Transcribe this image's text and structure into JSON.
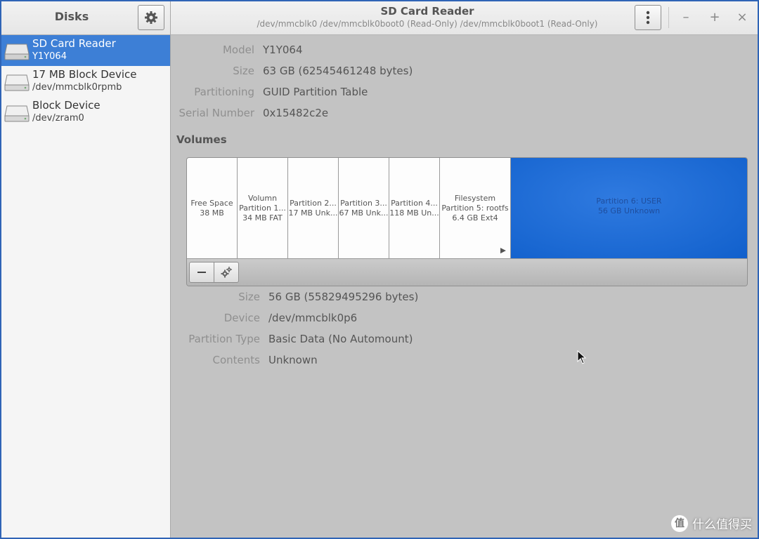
{
  "sidebar": {
    "title": "Disks",
    "disks": [
      {
        "name": "SD Card Reader",
        "sub": "Y1Y064",
        "selected": true
      },
      {
        "name": "17 MB Block Device",
        "sub": "/dev/mmcblk0rpmb",
        "selected": false
      },
      {
        "name": "Block Device",
        "sub": "/dev/zram0",
        "selected": false
      }
    ]
  },
  "header": {
    "title": "SD Card Reader",
    "subtitle": "/dev/mmcblk0 /dev/mmcblk0boot0 (Read-Only) /dev/mmcblk0boot1 (Read-Only)",
    "minimize": "–",
    "maximize": "+",
    "close": "×"
  },
  "drive_info": {
    "model_label": "Model",
    "model": "Y1Y064",
    "size_label": "Size",
    "size": "63 GB (62545461248 bytes)",
    "partitioning_label": "Partitioning",
    "partitioning": "GUID Partition Table",
    "serial_label": "Serial Number",
    "serial": "0x15482c2e"
  },
  "volumes": {
    "title": "Volumes",
    "partitions": [
      {
        "line1": "",
        "line2": "Free Space",
        "line3": "38 MB"
      },
      {
        "line1": "Volumn",
        "line2": "Partition 1...",
        "line3": "34 MB FAT"
      },
      {
        "line1": "",
        "line2": "Partition 2...",
        "line3": "17 MB Unk..."
      },
      {
        "line1": "",
        "line2": "Partition 3...",
        "line3": "67 MB Unk..."
      },
      {
        "line1": "",
        "line2": "Partition 4...",
        "line3": "118 MB Un..."
      },
      {
        "line1": "Filesystem",
        "line2": "Partition 5: rootfs",
        "line3": "6.4 GB Ext4"
      },
      {
        "line1": "",
        "line2": "Partition 6: USER",
        "line3": "56 GB Unknown"
      }
    ],
    "play_glyph": "▶"
  },
  "partition_info": {
    "size_label": "Size",
    "size": "56 GB (55829495296 bytes)",
    "device_label": "Device",
    "device": "/dev/mmcblk0p6",
    "type_label": "Partition Type",
    "type": "Basic Data (No Automount)",
    "contents_label": "Contents",
    "contents": "Unknown"
  },
  "watermark": {
    "badge": "值",
    "text": "什么值得买"
  },
  "colors": {
    "accent": "#3d7fd6",
    "selected_partition": "#1565d0",
    "background": "#c3c3c3"
  }
}
